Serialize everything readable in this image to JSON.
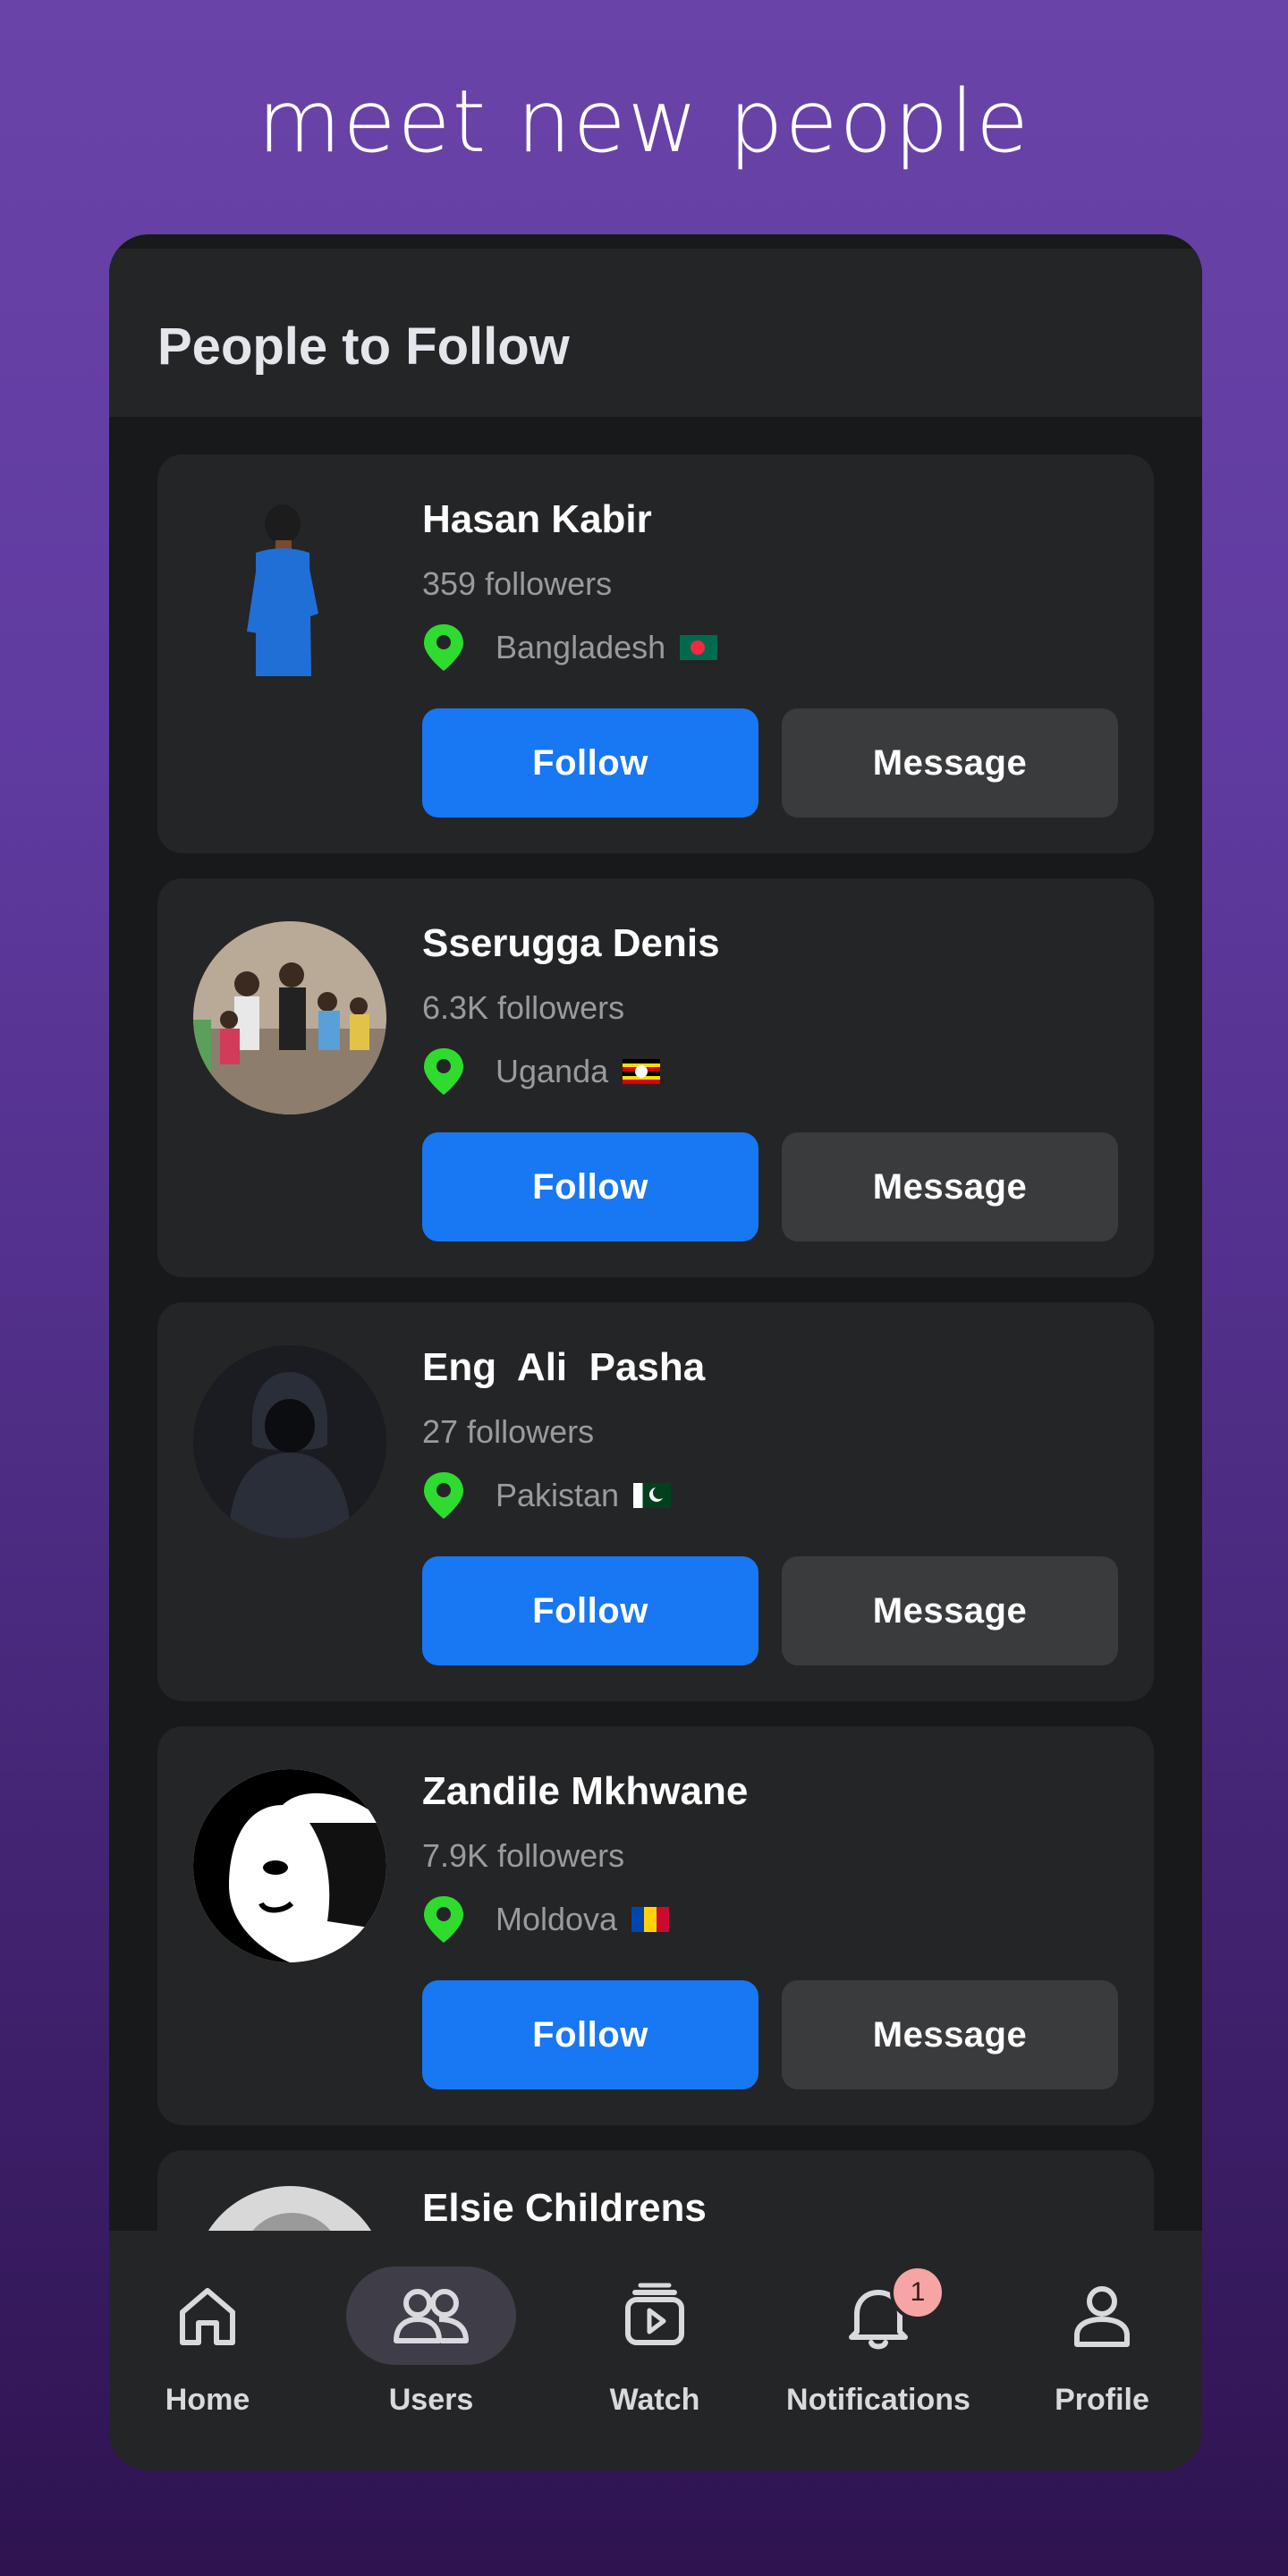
{
  "tagline": "meet new people",
  "section_title": "People to Follow",
  "people": [
    {
      "name": "Hasan Kabir",
      "followers": "359 followers",
      "country": "Bangladesh",
      "flag": "bangladesh-flag"
    },
    {
      "name": "Sserugga Denis",
      "followers": "6.3K followers",
      "country": "Uganda",
      "flag": "uganda-flag"
    },
    {
      "name": "Eng  Ali  Pasha",
      "followers": "27 followers",
      "country": "Pakistan",
      "flag": "pakistan-flag"
    },
    {
      "name": "Zandile Mkhwane",
      "followers": "7.9K followers",
      "country": "Moldova",
      "flag": "moldova-flag"
    },
    {
      "name": "Elsie Childrens"
    }
  ],
  "buttons": {
    "follow": "Follow",
    "message": "Message"
  },
  "nav": [
    {
      "label": "Home",
      "icon": "home-icon"
    },
    {
      "label": "Users",
      "icon": "users-icon",
      "active": true
    },
    {
      "label": "Watch",
      "icon": "watch-icon"
    },
    {
      "label": "Notifications",
      "icon": "bell-icon",
      "badge": "1"
    },
    {
      "label": "Profile",
      "icon": "profile-icon"
    }
  ],
  "colors": {
    "accent": "#1877f2",
    "location_pin": "#2edb2e",
    "card": "#242527",
    "background_top": "#6a43a8"
  }
}
